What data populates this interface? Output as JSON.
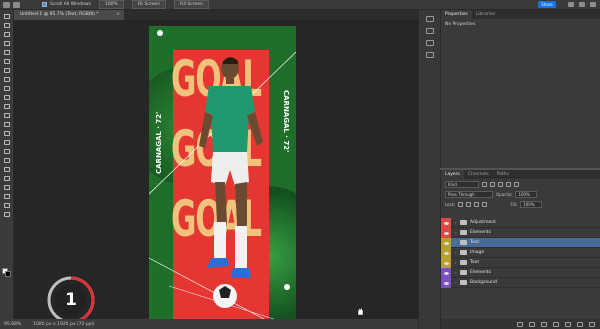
{
  "options_bar": {
    "scroll_all_label": "Scroll All Windows",
    "zoom_value": "100%",
    "fit_screen": "Fit Screen",
    "fill_screen": "Fill Screen",
    "share_label": "Share"
  },
  "document_tab": {
    "title": "Untitled-1 @ 95.7% (Text, RGB/8) *",
    "close": "×"
  },
  "artwork": {
    "goal_text": "GOAL",
    "left_vertical": "CARNAGAL · 72'",
    "right_vertical": "CARNAGAL · 72'"
  },
  "step_badge": {
    "number": "1"
  },
  "status_bar": {
    "zoom": "95.68%",
    "doc_size": "1080 px x 1920 px (72 ppi)"
  },
  "properties_panel": {
    "tabs": [
      "Properties",
      "Libraries"
    ],
    "message": "No Properties"
  },
  "layers_panel": {
    "tabs": [
      "Layers",
      "Channels",
      "Paths"
    ],
    "filter_kind": "Kind",
    "blend_mode": "Pass Through",
    "opacity_label": "Opacity:",
    "opacity_value": "100%",
    "lock_label": "Lock:",
    "fill_label": "Fill:",
    "fill_value": "100%",
    "layers": [
      {
        "name": "Adjustment",
        "color": "#e04848",
        "selected": false
      },
      {
        "name": "Elements",
        "color": "#e04848",
        "selected": false
      },
      {
        "name": "Text",
        "color": "#b7a02c",
        "selected": true
      },
      {
        "name": "Image",
        "color": "#b7a02c",
        "selected": false
      },
      {
        "name": "Text",
        "color": "#b7a02c",
        "selected": false
      },
      {
        "name": "Elements",
        "color": "#7a4fc0",
        "selected": false
      },
      {
        "name": "Background",
        "color": "#7a4fc0",
        "selected": false
      }
    ]
  }
}
